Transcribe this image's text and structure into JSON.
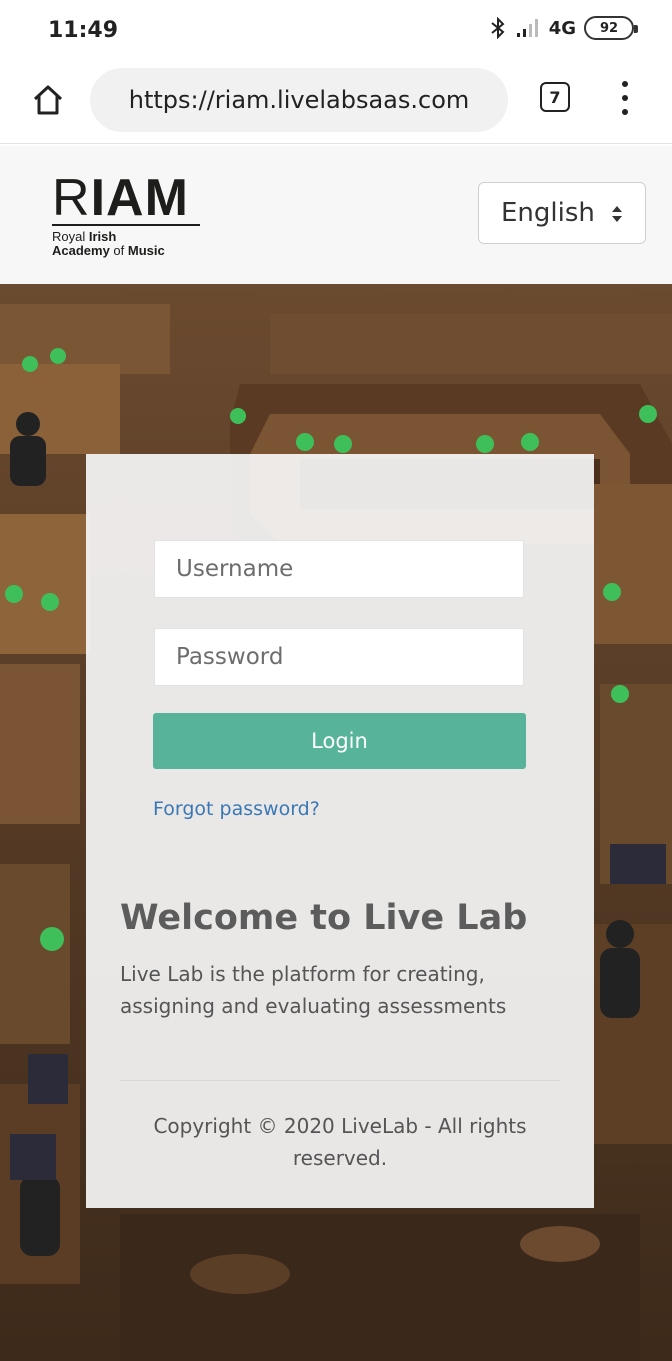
{
  "status_bar": {
    "time": "11:49",
    "network": "4G",
    "battery": "92",
    "icons": [
      "bluetooth-icon",
      "signal-icon",
      "battery-icon"
    ]
  },
  "browser": {
    "url": "https://riam.livelabsaas.com",
    "tab_count": "7",
    "icons": [
      "home-icon",
      "more-vert-icon"
    ]
  },
  "header": {
    "logo": {
      "main_light": "R",
      "main_bold": "IAM",
      "line1_light": "Royal ",
      "line1_bold": "Irish",
      "line2_bold_a": "Academy",
      "line2_light": " of ",
      "line2_bold_b": "Music"
    },
    "language": {
      "selected": "English",
      "icon": "select-arrows-icon"
    }
  },
  "login": {
    "username_placeholder": "Username",
    "password_placeholder": "Password",
    "login_label": "Login",
    "forgot_label": "Forgot password?",
    "welcome_title": "Welcome to Live Lab",
    "welcome_text": "Live Lab is the platform for creating, assigning and evaluating assessments",
    "copyright": "Copyright © 2020 LiveLab - All rights reserved."
  },
  "colors": {
    "accent": "#57b49a",
    "link": "#3a78b5",
    "heading": "#5c5c5c"
  }
}
